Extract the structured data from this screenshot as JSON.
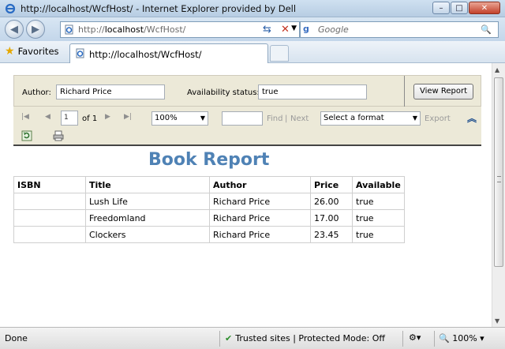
{
  "window": {
    "title": "http://localhost/WcfHost/ - Internet Explorer provided by Dell",
    "minimize": "–",
    "maximize": "□",
    "close": "✕"
  },
  "address_bar": {
    "url_prefix": "http://",
    "url_host": "localhost",
    "url_path": "/WcfHost/",
    "dropdown": "▼"
  },
  "search": {
    "engine_glyph": "g",
    "placeholder": "Google",
    "mag": "🔍"
  },
  "favorites": {
    "label": "Favorites"
  },
  "tab": {
    "label": "http://localhost/WcfHost/"
  },
  "parameters": {
    "author_label": "Author:",
    "author_value": "Richard Price",
    "availability_label": "Availability status:",
    "availability_value": "true",
    "view_report": "View Report"
  },
  "toolbar": {
    "first": "|◀",
    "prev": "◀",
    "page_value": "1",
    "of_label": "of 1",
    "next": "▶",
    "last": "▶|",
    "zoom": "100%",
    "find_label": "Find",
    "pipe": "|",
    "next_label": "Next",
    "format_placeholder": "Select a format",
    "export_label": "Export",
    "collapse": "︽",
    "dropdown": "▼"
  },
  "report": {
    "title": "Book Report",
    "columns": [
      "ISBN",
      "Title",
      "Author",
      "Price",
      "Available"
    ],
    "rows": [
      [
        "",
        "Lush Life",
        "Richard Price",
        "26.00",
        "true"
      ],
      [
        "",
        "Freedomland",
        "Richard Price",
        "17.00",
        "true"
      ],
      [
        "",
        "Clockers",
        "Richard Price",
        "23.45",
        "true"
      ]
    ]
  },
  "status": {
    "left": "Done",
    "zone": "Trusted sites | Protected Mode: Off",
    "zoom": "100%",
    "check": "✔"
  },
  "colors": {
    "report_title": "#4f82b5",
    "toolbar_bg": "#ece9d8",
    "chrome_blue": "#c3d6ea"
  }
}
